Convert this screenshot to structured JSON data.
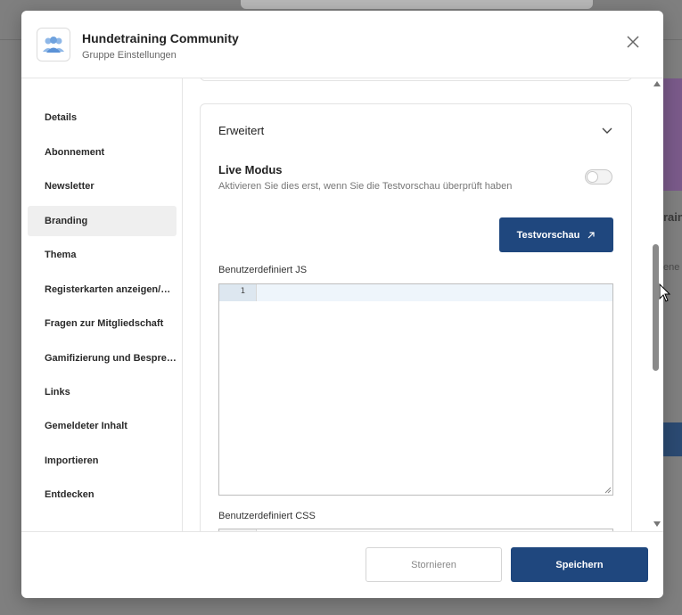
{
  "background": {
    "fragments": [
      "rain",
      "ene"
    ]
  },
  "header": {
    "title": "Hundetraining Community",
    "subtitle": "Gruppe Einstellungen",
    "logo_icon": "group-people-icon",
    "close_icon": "close-icon"
  },
  "sidebar": {
    "active": "Branding",
    "items": [
      {
        "label": "Details"
      },
      {
        "label": "Abonnement"
      },
      {
        "label": "Newsletter"
      },
      {
        "label": "Branding"
      },
      {
        "label": "Thema"
      },
      {
        "label": "Registerkarten anzeigen/…"
      },
      {
        "label": "Fragen zur Mitgliedschaft"
      },
      {
        "label": "Gamifizierung und Bespre…"
      },
      {
        "label": "Links"
      },
      {
        "label": "Gemeldeter Inhalt"
      },
      {
        "label": "Importieren"
      },
      {
        "label": "Entdecken"
      }
    ]
  },
  "advanced": {
    "title": "Erweitert",
    "live_mode_label": "Live Modus",
    "live_mode_description": "Aktivieren Sie dies erst, wenn Sie die Testvorschau überprüft haben",
    "live_mode_enabled": false,
    "preview_button": "Testvorschau",
    "preview_icon": "external-link-icon",
    "custom_js_label": "Benutzerdefiniert JS",
    "custom_js_line": "1",
    "custom_js_value": "",
    "custom_css_label": "Benutzerdefiniert CSS"
  },
  "footer": {
    "cancel_label": "Stornieren",
    "save_label": "Speichern"
  },
  "colors": {
    "primary": "#1f477e",
    "active_nav": "#efefef"
  }
}
